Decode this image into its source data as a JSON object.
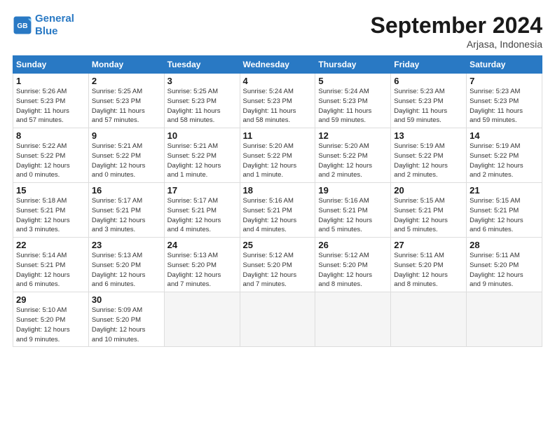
{
  "logo": {
    "line1": "General",
    "line2": "Blue"
  },
  "title": "September 2024",
  "subtitle": "Arjasa, Indonesia",
  "headers": [
    "Sunday",
    "Monday",
    "Tuesday",
    "Wednesday",
    "Thursday",
    "Friday",
    "Saturday"
  ],
  "weeks": [
    [
      {
        "day": "1",
        "info": "Sunrise: 5:26 AM\nSunset: 5:23 PM\nDaylight: 11 hours\nand 57 minutes."
      },
      {
        "day": "2",
        "info": "Sunrise: 5:25 AM\nSunset: 5:23 PM\nDaylight: 11 hours\nand 57 minutes."
      },
      {
        "day": "3",
        "info": "Sunrise: 5:25 AM\nSunset: 5:23 PM\nDaylight: 11 hours\nand 58 minutes."
      },
      {
        "day": "4",
        "info": "Sunrise: 5:24 AM\nSunset: 5:23 PM\nDaylight: 11 hours\nand 58 minutes."
      },
      {
        "day": "5",
        "info": "Sunrise: 5:24 AM\nSunset: 5:23 PM\nDaylight: 11 hours\nand 59 minutes."
      },
      {
        "day": "6",
        "info": "Sunrise: 5:23 AM\nSunset: 5:23 PM\nDaylight: 11 hours\nand 59 minutes."
      },
      {
        "day": "7",
        "info": "Sunrise: 5:23 AM\nSunset: 5:23 PM\nDaylight: 11 hours\nand 59 minutes."
      }
    ],
    [
      {
        "day": "8",
        "info": "Sunrise: 5:22 AM\nSunset: 5:22 PM\nDaylight: 12 hours\nand 0 minutes."
      },
      {
        "day": "9",
        "info": "Sunrise: 5:21 AM\nSunset: 5:22 PM\nDaylight: 12 hours\nand 0 minutes."
      },
      {
        "day": "10",
        "info": "Sunrise: 5:21 AM\nSunset: 5:22 PM\nDaylight: 12 hours\nand 1 minute."
      },
      {
        "day": "11",
        "info": "Sunrise: 5:20 AM\nSunset: 5:22 PM\nDaylight: 12 hours\nand 1 minute."
      },
      {
        "day": "12",
        "info": "Sunrise: 5:20 AM\nSunset: 5:22 PM\nDaylight: 12 hours\nand 2 minutes."
      },
      {
        "day": "13",
        "info": "Sunrise: 5:19 AM\nSunset: 5:22 PM\nDaylight: 12 hours\nand 2 minutes."
      },
      {
        "day": "14",
        "info": "Sunrise: 5:19 AM\nSunset: 5:22 PM\nDaylight: 12 hours\nand 2 minutes."
      }
    ],
    [
      {
        "day": "15",
        "info": "Sunrise: 5:18 AM\nSunset: 5:21 PM\nDaylight: 12 hours\nand 3 minutes."
      },
      {
        "day": "16",
        "info": "Sunrise: 5:17 AM\nSunset: 5:21 PM\nDaylight: 12 hours\nand 3 minutes."
      },
      {
        "day": "17",
        "info": "Sunrise: 5:17 AM\nSunset: 5:21 PM\nDaylight: 12 hours\nand 4 minutes."
      },
      {
        "day": "18",
        "info": "Sunrise: 5:16 AM\nSunset: 5:21 PM\nDaylight: 12 hours\nand 4 minutes."
      },
      {
        "day": "19",
        "info": "Sunrise: 5:16 AM\nSunset: 5:21 PM\nDaylight: 12 hours\nand 5 minutes."
      },
      {
        "day": "20",
        "info": "Sunrise: 5:15 AM\nSunset: 5:21 PM\nDaylight: 12 hours\nand 5 minutes."
      },
      {
        "day": "21",
        "info": "Sunrise: 5:15 AM\nSunset: 5:21 PM\nDaylight: 12 hours\nand 6 minutes."
      }
    ],
    [
      {
        "day": "22",
        "info": "Sunrise: 5:14 AM\nSunset: 5:21 PM\nDaylight: 12 hours\nand 6 minutes."
      },
      {
        "day": "23",
        "info": "Sunrise: 5:13 AM\nSunset: 5:20 PM\nDaylight: 12 hours\nand 6 minutes."
      },
      {
        "day": "24",
        "info": "Sunrise: 5:13 AM\nSunset: 5:20 PM\nDaylight: 12 hours\nand 7 minutes."
      },
      {
        "day": "25",
        "info": "Sunrise: 5:12 AM\nSunset: 5:20 PM\nDaylight: 12 hours\nand 7 minutes."
      },
      {
        "day": "26",
        "info": "Sunrise: 5:12 AM\nSunset: 5:20 PM\nDaylight: 12 hours\nand 8 minutes."
      },
      {
        "day": "27",
        "info": "Sunrise: 5:11 AM\nSunset: 5:20 PM\nDaylight: 12 hours\nand 8 minutes."
      },
      {
        "day": "28",
        "info": "Sunrise: 5:11 AM\nSunset: 5:20 PM\nDaylight: 12 hours\nand 9 minutes."
      }
    ],
    [
      {
        "day": "29",
        "info": "Sunrise: 5:10 AM\nSunset: 5:20 PM\nDaylight: 12 hours\nand 9 minutes."
      },
      {
        "day": "30",
        "info": "Sunrise: 5:09 AM\nSunset: 5:20 PM\nDaylight: 12 hours\nand 10 minutes."
      },
      {
        "day": "",
        "info": ""
      },
      {
        "day": "",
        "info": ""
      },
      {
        "day": "",
        "info": ""
      },
      {
        "day": "",
        "info": ""
      },
      {
        "day": "",
        "info": ""
      }
    ]
  ]
}
